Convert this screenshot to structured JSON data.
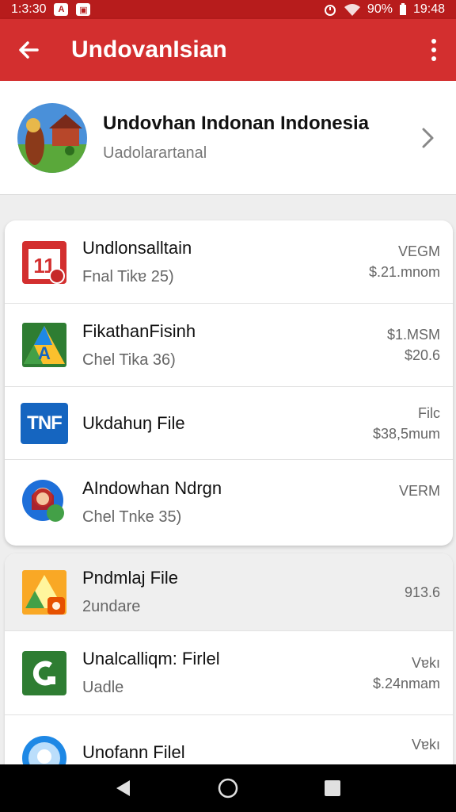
{
  "status_bar": {
    "time_left": "1:3:30",
    "battery": "90%",
    "time_right": "19:48"
  },
  "app_bar": {
    "title": "UndovanIsian",
    "back_icon": "back-arrow-icon",
    "menu_icon": "more-vert-icon"
  },
  "profile": {
    "name": "Undovhan Indonan Indonesia",
    "subtitle": "Uadolarartanal",
    "chevron_icon": "chevron-right-icon"
  },
  "items": [
    {
      "title": "Undlonsalltain",
      "subtitle": "Fnal Tikɐ 25)",
      "right_top": "VEGM",
      "right_bottom": "$.21.mnom",
      "icon": "calendar-app-icon"
    },
    {
      "title": "FikathanFisinh",
      "subtitle": "Chel Tika 36)",
      "right_top": "$1.MSM",
      "right_bottom": "$20.6",
      "icon": "drive-app-icon"
    },
    {
      "title": "Ukdahuŋ File",
      "subtitle": "",
      "right_top": "Filc",
      "right_bottom": "$38,5mum",
      "icon": "tnf-app-icon",
      "icon_text": "TNF"
    },
    {
      "title": "AIndowhan Ndrgn",
      "subtitle": "Chel Tnke 35)",
      "right_top": "VERM",
      "right_bottom": "",
      "icon": "avatar-app-icon"
    },
    {
      "title": "Pndmlaj File",
      "subtitle": "2undare",
      "right_top": "",
      "right_bottom": "913.6",
      "icon": "drive-folder-icon"
    },
    {
      "title": "Unalcalliqm: Firlel",
      "subtitle": "Uadle",
      "right_top": "Vɐkı",
      "right_bottom": "$.24nmam",
      "icon": "green-app-icon"
    },
    {
      "title": "Unofann Filel",
      "subtitle": "",
      "right_top": "Vɐkı",
      "right_bottom": "",
      "icon": "blue-app-icon"
    }
  ],
  "nav": {
    "back": "nav-back-icon",
    "home": "nav-home-icon",
    "recents": "nav-recents-icon"
  },
  "colors": {
    "primary": "#d32f2f",
    "primary_dark": "#b71c1c",
    "background": "#eeeeee"
  }
}
